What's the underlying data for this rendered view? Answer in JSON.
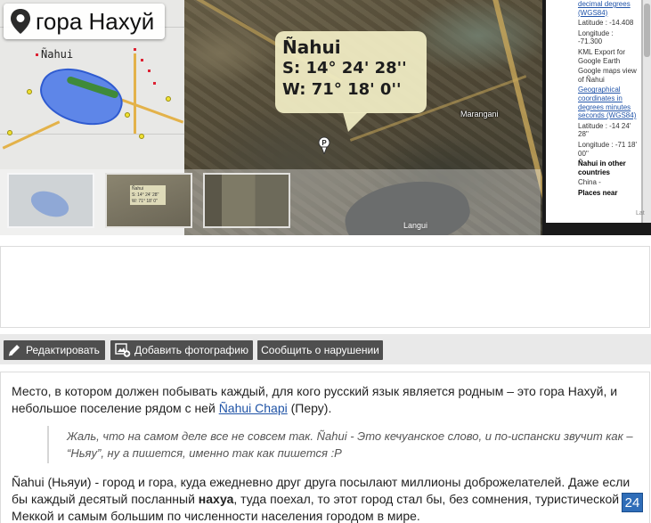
{
  "hero": {
    "title": "гора Нахуй",
    "map_label": "Ñahui",
    "callout": {
      "name": "Ñahui",
      "lat_label": "S:",
      "lat_value": "14° 24' 28''",
      "lon_label": "W:",
      "lon_value": "71° 18' 0''"
    },
    "place_labels": {
      "marangani": "Marangani",
      "langui": "Langui"
    },
    "thumb_card_lines": [
      "Ñahui",
      "S: 14° 24' 28''",
      "W: 71° 18' 0''"
    ],
    "side_panel": {
      "block1_link": "decimal degrees (WGS84)",
      "block1_lines": [
        "Latitude : -14.408",
        "Longitude : -71.300"
      ],
      "kml_link": "KML Export for Google Earth",
      "gmaps_link": "Google maps view of Ñahui",
      "block2_link": "Geographical coordinates in degrees minutes seconds (WGS84)",
      "block2_lines": [
        "Latitude : -14 24' 28''",
        "Longitude : -71 18' 00''"
      ],
      "block3_head": "Ñahui in other countries",
      "block3_lines": [
        "China -",
        "Places near"
      ],
      "corner_text": "Lat"
    }
  },
  "actions": {
    "edit": "Редактировать",
    "add_photo": "Добавить фотографию",
    "report": "Сообщить о нарушении"
  },
  "article": {
    "p1_before_link": "Место, в котором должен побывать каждый, для кого русский язык является родным – это гора Нахуй, и небольшое поселение рядом с ней ",
    "p1_link": "Ñahui Chapi",
    "p1_after_link": " (Перу).",
    "quote": "Жаль, что на самом деле все не совсем так. Ñahui - Это кечуанское слово, и по-испански звучит как – “Ньяу”, ну а пишется, именно так как пишется :P",
    "p2_before_bold": "Ñahui (Ньяуи) - город и гора, куда ежедневно друг друга посылают миллионы доброжелателей. Даже если бы каждый десятый посланный ",
    "p2_bold": "нахуа",
    "p2_after_bold": ", туда поехал, то этот город стал бы, без сомнения, туристической Меккой и самым большим по численности населения городом в мире."
  },
  "counter": "24",
  "colors": {
    "button_bg": "#4f4f4f",
    "link": "#1f53a6",
    "callout_bg": "#f0ecc4",
    "lake": "#5e86e8",
    "counter_bg": "#2f6db8"
  },
  "icons": [
    "map-pin-icon",
    "edit-icon",
    "add-photo-icon",
    "place-marker-icon"
  ]
}
